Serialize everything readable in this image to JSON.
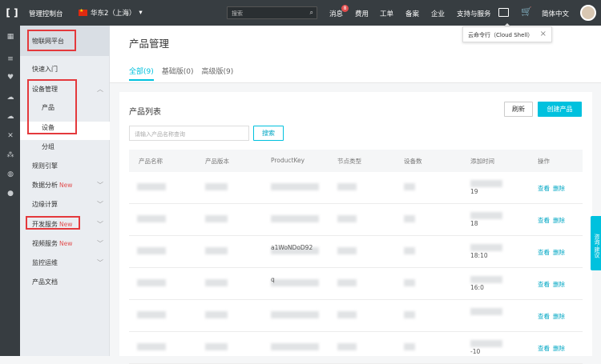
{
  "topbar": {
    "console": "管理控制台",
    "region": "华东2（上海）",
    "search_placeholder": "搜索",
    "nav": [
      "消息",
      "费用",
      "工单",
      "备案",
      "企业",
      "支持与服务"
    ],
    "message_badge": "8",
    "language": "简体中文"
  },
  "tooltip": {
    "text": "云命令行（Cloud Shell）"
  },
  "sidebar": {
    "platform": "物联网平台",
    "items": [
      {
        "label": "快速入门"
      },
      {
        "label": "设备管理"
      },
      {
        "label": "产品"
      },
      {
        "label": "设备"
      },
      {
        "label": "分组"
      },
      {
        "label": "规则引擎"
      },
      {
        "label": "数据分析",
        "badge": "New"
      },
      {
        "label": "边缘计算"
      },
      {
        "label": "开发服务",
        "badge": "New"
      },
      {
        "label": "视频服务",
        "badge": "New"
      },
      {
        "label": "监控运维"
      },
      {
        "label": "产品文档"
      }
    ]
  },
  "main": {
    "title": "产品管理",
    "tabs": [
      "全部(9)",
      "基础版(0)",
      "高级版(9)"
    ],
    "panel_title": "产品列表",
    "refresh_label": "刷新",
    "create_label": "创建产品",
    "search_placeholder": "请输入产品名称查询",
    "search_label": "搜索",
    "columns": [
      "产品名称",
      "产品版本",
      "ProductKey",
      "节点类型",
      "设备数",
      "添加时间",
      "操作"
    ],
    "rows": [
      {
        "key_frag": "",
        "time_frag": "19",
        "view": "查看",
        "delete": "删除"
      },
      {
        "key_frag": "",
        "time_frag": "18",
        "view": "查看",
        "delete": "删除"
      },
      {
        "key_frag": "a1WoNDoD92",
        "time_frag": "18:10",
        "view": "查看",
        "delete": "删除"
      },
      {
        "key_frag": "q",
        "time_frag": "16:0",
        "view": "查看",
        "delete": "删除"
      },
      {
        "key_frag": "",
        "time_frag": "",
        "view": "查看",
        "delete": "删除"
      },
      {
        "key_frag": "",
        "time_frag": "-10",
        "view": "查看",
        "delete": "删除"
      }
    ]
  },
  "consult": "咨询·建议"
}
